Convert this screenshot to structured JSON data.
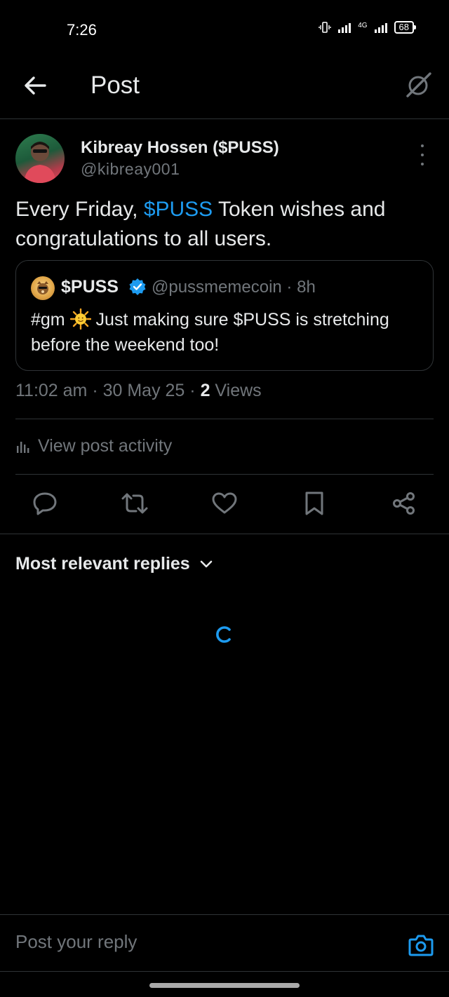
{
  "status_bar": {
    "time": "7:26",
    "network": "4G",
    "battery": "68"
  },
  "header": {
    "title": "Post"
  },
  "post": {
    "author_name": "Kibreay Hossen ($PUSS)",
    "author_handle": "@kibreay001",
    "text_before": "Every Friday, ",
    "text_cashtag": "$PUSS",
    "text_after": " Token wishes and congratulations to all users.",
    "timestamp": "11:02 am · 30 May 25 · ",
    "views_count": "2",
    "views_label": " Views",
    "activity_label": "View post activity"
  },
  "quote": {
    "name": "$PUSS",
    "handle": "@pussmemecoin · 8h",
    "text_before": "#gm ",
    "text_after": " Just making sure $PUSS is stretching before the weekend too!"
  },
  "replies": {
    "sort_label": "Most relevant replies"
  },
  "reply_bar": {
    "placeholder": "Post your reply"
  },
  "colors": {
    "background": "#000000",
    "text_primary": "#e7e9ea",
    "text_secondary": "#71767b",
    "accent": "#1d9bf0",
    "divider": "#2f3336"
  },
  "icons": {
    "back": "arrow-left-icon",
    "grok": "grok-icon",
    "more": "more-vertical-icon",
    "verified": "verified-badge-icon",
    "activity": "bar-chart-icon",
    "reply": "comment-icon",
    "repost": "repost-icon",
    "like": "heart-icon",
    "bookmark": "bookmark-icon",
    "share": "share-icon",
    "sort": "chevron-down-icon",
    "loading": "loading-spinner-icon",
    "camera": "camera-icon"
  }
}
